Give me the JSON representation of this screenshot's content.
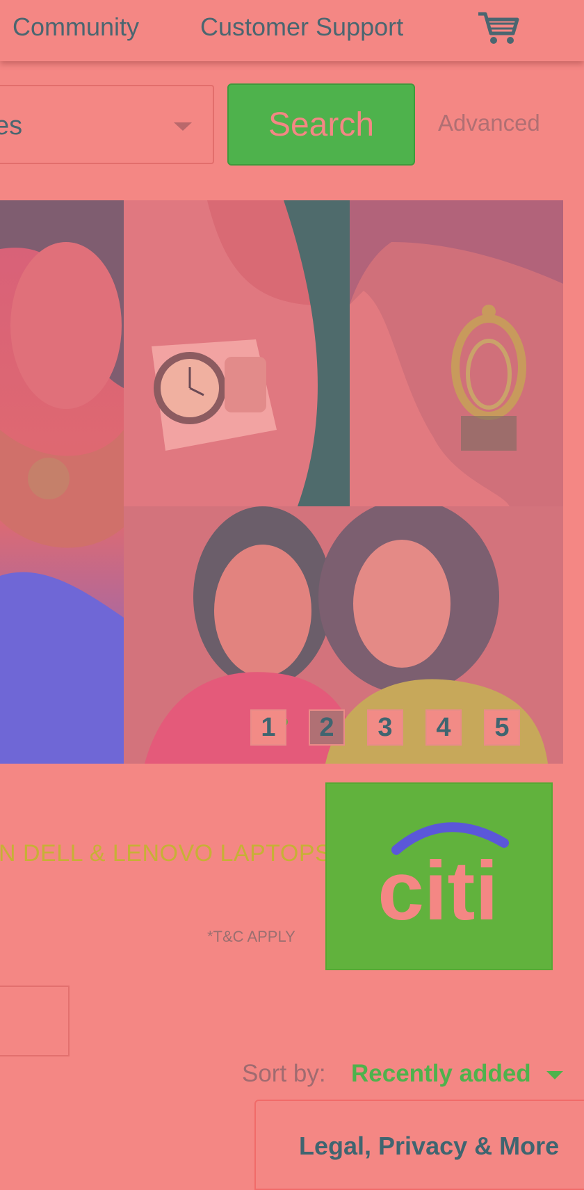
{
  "nav": {
    "community": "Community",
    "customer_support": "Customer Support",
    "cart_icon": "shopping-cart-icon"
  },
  "search": {
    "category_value": "es",
    "button_label": "Search",
    "advanced_label": "Advanced"
  },
  "hero": {
    "pages": [
      "1",
      "2",
      "3",
      "4",
      "5"
    ],
    "active_page": "2"
  },
  "promo": {
    "text": "N DELL & LENOVO LAPTOPS",
    "terms": "*T&C APPLY",
    "brand": "citi"
  },
  "sort": {
    "label": "Sort by:",
    "value": "Recently added"
  },
  "footer": {
    "legal": "Legal, Privacy & More"
  },
  "colors": {
    "background": "#f48784",
    "accent_green": "#4eb24c",
    "text": "#4a6670",
    "citi_blue": "#5b57d9"
  }
}
